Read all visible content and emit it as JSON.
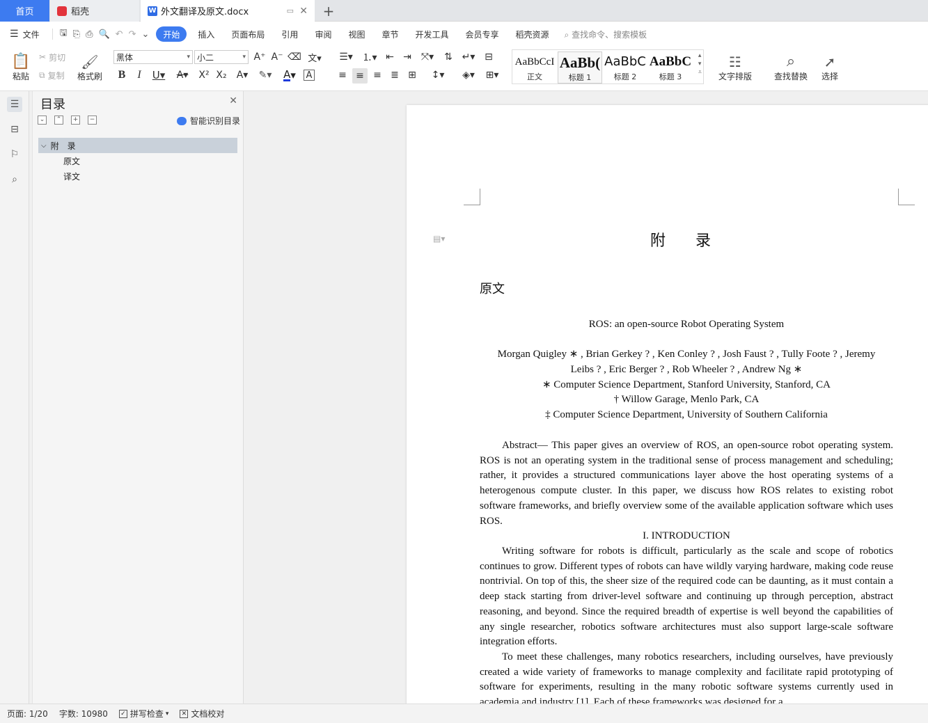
{
  "tabs": {
    "home": "首页",
    "daoke": "稻壳",
    "doc": "外文翻译及原文.docx",
    "doc_icon_letter": "W",
    "add": "+",
    "close": "✕"
  },
  "menu": {
    "file": "文件",
    "items": [
      "开始",
      "插入",
      "页面布局",
      "引用",
      "审阅",
      "视图",
      "章节",
      "开发工具",
      "会员专享",
      "稻壳资源"
    ],
    "search": "查找命令、搜索模板"
  },
  "ribbon": {
    "paste": "粘贴",
    "cut": "剪切",
    "copy": "复制",
    "format_painter": "格式刷",
    "font": "黑体",
    "size": "小二",
    "styles": [
      {
        "preview": "AaBbCcI",
        "name": "正文"
      },
      {
        "preview": "AaBb(",
        "name": "标题 1"
      },
      {
        "preview": "AaBbC",
        "name": "标题 2"
      },
      {
        "preview": "AaBbC",
        "name": "标题 3"
      }
    ],
    "text_layout": "文字排版",
    "find_replace": "查找替换",
    "select": "选择"
  },
  "toc": {
    "title": "目录",
    "smart": "智能识别目录",
    "items": [
      {
        "label": "附　录",
        "level": 1,
        "expanded": true
      },
      {
        "label": "原文",
        "level": 2
      },
      {
        "label": "译文",
        "level": 2
      }
    ]
  },
  "document": {
    "heading": "附 录",
    "section": "原文",
    "paper_title": "ROS: an open-source Robot Operating System",
    "authors_line1": "Morgan Quigley ∗ , Brian Gerkey ? , Ken Conley ? , Josh Faust ? , Tully Foote ? , Jeremy",
    "authors_line2": "Leibs ? , Eric Berger ? , Rob Wheeler ? , Andrew Ng ∗",
    "affil1": "∗ Computer Science Department, Stanford University, Stanford, CA",
    "affil2": "† Willow Garage, Menlo Park, CA",
    "affil3": "‡ Computer Science Department, University of Southern California",
    "abstract": "Abstract— This paper gives an overview of ROS, an open-source robot operating system. ROS is not an operating system in the traditional sense of process management and scheduling; rather, it provides a structured communications layer above the host operating systems of a heterogenous compute cluster. In this paper, we discuss how ROS relates to existing robot software frameworks, and briefly overview some of the available application software which uses ROS.",
    "intro_heading": "I. INTRODUCTION",
    "para1": "Writing software for robots is difficult, particularly as the scale and scope of robotics continues to grow. Different types of robots can have wildly varying hardware, making code reuse nontrivial. On top of this, the sheer size of the required code can be daunting, as it must contain a deep stack starting from driver-level software and continuing up through perception, abstract reasoning, and beyond. Since the required breadth of expertise is well beyond the capabilities of any single researcher, robotics software architectures must also support large-scale software integration efforts.",
    "para2": "To meet these challenges, many robotics researchers, including ourselves, have previously created a wide variety of frameworks to manage complexity and facilitate rapid prototyping of software for experiments, resulting in the many robotic software systems currently used in academia and industry [1]. Each of these frameworks was designed for a"
  },
  "status": {
    "page": "页面: 1/20",
    "words": "字数: 10980",
    "spell": "拼写检查",
    "proof": "文档校对"
  }
}
